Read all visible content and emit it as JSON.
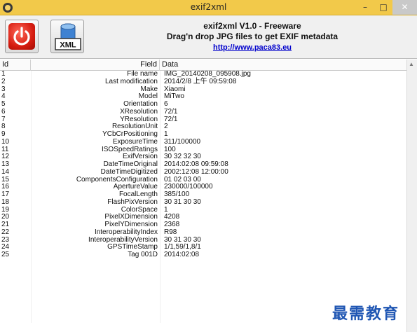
{
  "window": {
    "title": "exif2xml",
    "minimize_glyph": "–",
    "maximize_glyph": "□",
    "close_glyph": "✕"
  },
  "header": {
    "line1": "exif2xml V1.0 - Freeware",
    "line2": "Drag'n drop JPG files to get EXIF metadata",
    "link": "http://www.paca83.eu",
    "xml_button_label": "XML"
  },
  "table": {
    "columns": {
      "id": "Id",
      "field": "Field",
      "data": "Data"
    },
    "rows": [
      {
        "id": "1",
        "field": "File name",
        "data": "IMG_20140208_095908.jpg"
      },
      {
        "id": "2",
        "field": "Last modification",
        "data": "2014/2/8 上午 09:59:08"
      },
      {
        "id": "3",
        "field": "Make",
        "data": "Xiaomi"
      },
      {
        "id": "4",
        "field": "Model",
        "data": "MiTwo"
      },
      {
        "id": "5",
        "field": "Orientation",
        "data": "6"
      },
      {
        "id": "6",
        "field": "XResolution",
        "data": "72/1"
      },
      {
        "id": "7",
        "field": "YResolution",
        "data": "72/1"
      },
      {
        "id": "8",
        "field": "ResolutionUnit",
        "data": "2"
      },
      {
        "id": "9",
        "field": "YCbCrPositioning",
        "data": "1"
      },
      {
        "id": "10",
        "field": "ExposureTime",
        "data": "311/100000"
      },
      {
        "id": "11",
        "field": "ISOSpeedRatings",
        "data": "100"
      },
      {
        "id": "12",
        "field": "ExifVersion",
        "data": "30 32 32 30"
      },
      {
        "id": "13",
        "field": "DateTimeOriginal",
        "data": "2014:02:08 09:59:08"
      },
      {
        "id": "14",
        "field": "DateTimeDigitized",
        "data": "2002:12:08 12:00:00"
      },
      {
        "id": "15",
        "field": "ComponentsConfiguration",
        "data": "01 02 03 00"
      },
      {
        "id": "16",
        "field": "ApertureValue",
        "data": "230000/100000"
      },
      {
        "id": "17",
        "field": "FocalLength",
        "data": "385/100"
      },
      {
        "id": "18",
        "field": "FlashPixVersion",
        "data": "30 31 30 30"
      },
      {
        "id": "19",
        "field": "ColorSpace",
        "data": "1"
      },
      {
        "id": "20",
        "field": "PixelXDimension",
        "data": "4208"
      },
      {
        "id": "21",
        "field": "PixelYDimension",
        "data": "2368"
      },
      {
        "id": "22",
        "field": "InteroperabilityIndex",
        "data": "R98"
      },
      {
        "id": "23",
        "field": "InteroperabilityVersion",
        "data": "30 31 30 30"
      },
      {
        "id": "24",
        "field": "GPSTimeStamp",
        "data": "1/1,59/1,8/1"
      },
      {
        "id": "25",
        "field": "Tag 001D",
        "data": "2014:02:08"
      }
    ]
  },
  "watermark": "最需教育",
  "colors": {
    "titlebar": "#f2c94a",
    "power_red": "#d61c10",
    "link_blue": "#0000cc",
    "watermark_blue": "#1f56b3"
  }
}
